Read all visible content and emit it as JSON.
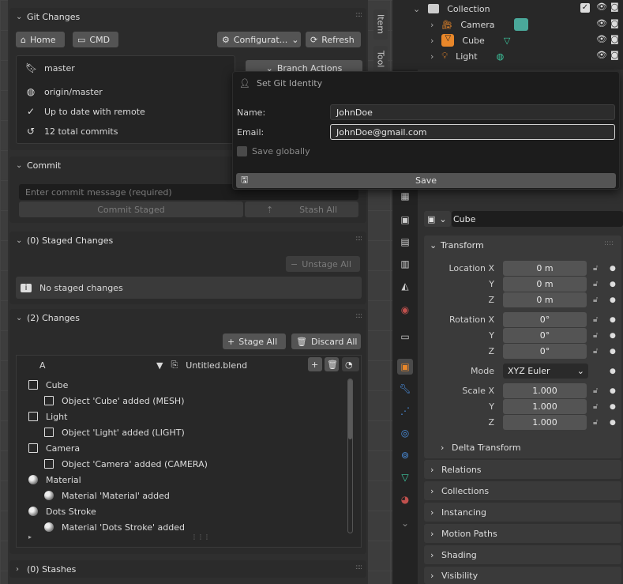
{
  "git_changes": {
    "title": "Git Changes",
    "home_label": "Home",
    "cmd_label": "CMD",
    "config_label": "Configurat...",
    "refresh_label": "Refresh",
    "branch": "master",
    "branch_actions_label": "Branch Actions",
    "remote": "origin/master",
    "status": "Up to date with remote",
    "commits": "12 total commits"
  },
  "commit": {
    "title": "Commit",
    "placeholder": "Enter commit message (required)",
    "commit_staged_label": "Commit Staged",
    "stash_all_label": "Stash All"
  },
  "staged": {
    "title": "(0) Staged Changes",
    "unstage_all_label": "Unstage All",
    "empty_text": "No staged changes"
  },
  "changes": {
    "title": "(2) Changes",
    "stage_all_label": "Stage All",
    "discard_all_label": "Discard All",
    "list_header_col": "A",
    "file_name": "Untitled.blend",
    "items": [
      {
        "label": "Cube",
        "level": 0,
        "kind": "object"
      },
      {
        "label": "Object 'Cube' added (MESH)",
        "level": 1,
        "kind": "object"
      },
      {
        "label": "Light",
        "level": 0,
        "kind": "object"
      },
      {
        "label": "Object 'Light' added (LIGHT)",
        "level": 1,
        "kind": "object"
      },
      {
        "label": "Camera",
        "level": 0,
        "kind": "object"
      },
      {
        "label": "Object 'Camera' added (CAMERA)",
        "level": 1,
        "kind": "object"
      },
      {
        "label": "Material",
        "level": 0,
        "kind": "material"
      },
      {
        "label": "Material 'Material' added",
        "level": 1,
        "kind": "material"
      },
      {
        "label": "Dots Stroke",
        "level": 0,
        "kind": "material"
      },
      {
        "label": "Material 'Dots Stroke' added",
        "level": 1,
        "kind": "material"
      }
    ]
  },
  "stashes": {
    "title": "(0) Stashes"
  },
  "side_tabs": {
    "item": "Item",
    "tool": "Tool"
  },
  "outliner": {
    "collection": "Collection",
    "items": [
      "Camera",
      "Cube",
      "Light"
    ]
  },
  "popup": {
    "title": "Set Git Identity",
    "name_label": "Name:",
    "name_value": "JohnDoe",
    "email_label": "Email:",
    "email_value": "JohnDoe@gmail.com",
    "save_globally_label": "Save globally",
    "save_label": "Save"
  },
  "properties": {
    "object_name": "Cube",
    "transform_title": "Transform",
    "location_label": "Location X",
    "y_label": "Y",
    "z_label": "Z",
    "location": [
      "0 m",
      "0 m",
      "0 m"
    ],
    "rotation_label": "Rotation X",
    "rotation": [
      "0°",
      "0°",
      "0°"
    ],
    "mode_label": "Mode",
    "mode_value": "XYZ Euler",
    "scale_label": "Scale X",
    "scale": [
      "1.000",
      "1.000",
      "1.000"
    ],
    "delta_transform": "Delta Transform",
    "collapsed_panels": [
      "Relations",
      "Collections",
      "Instancing",
      "Motion Paths",
      "Shading",
      "Visibility"
    ]
  },
  "colors": {
    "accent": "#4772b3",
    "camera_icon": "#4aa89a",
    "mesh_icon": "#3dc9a0",
    "orange": "#e8872a"
  }
}
